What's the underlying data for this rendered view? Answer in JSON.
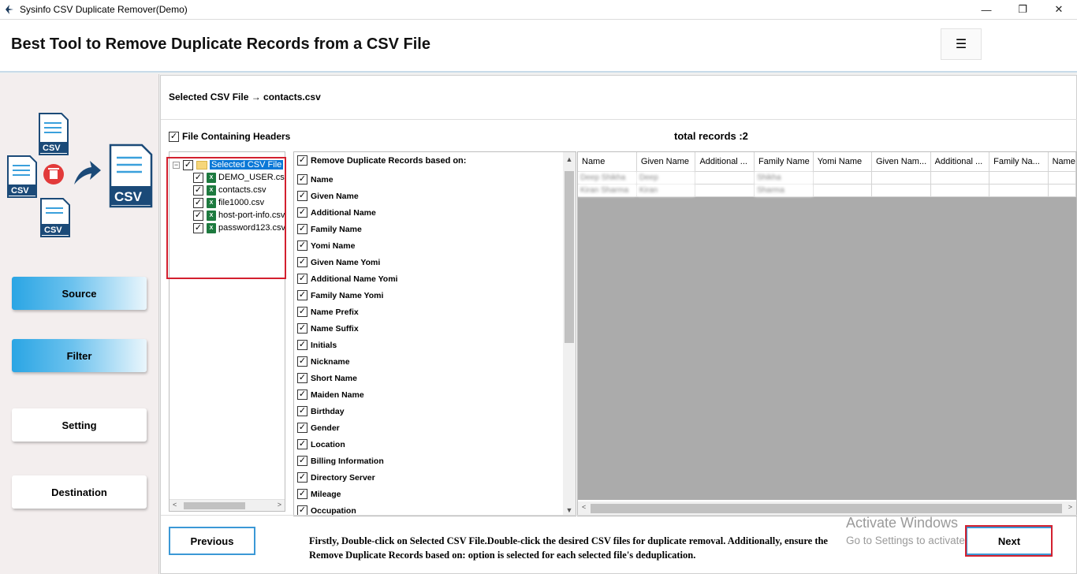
{
  "window": {
    "title": "Sysinfo CSV Duplicate Remover(Demo)",
    "minimize_glyph": "—",
    "restore_glyph": "❐",
    "close_glyph": "✕"
  },
  "header": {
    "heading": "Best Tool to Remove Duplicate Records from a CSV File",
    "menu_glyph": "☰"
  },
  "sidebar": {
    "logo_csv_label": "CSV",
    "nav": [
      {
        "label": "Source",
        "active": true
      },
      {
        "label": "Filter",
        "active": true
      },
      {
        "label": "Setting",
        "active": false
      },
      {
        "label": "Destination",
        "active": false
      }
    ]
  },
  "main": {
    "selected_file_text": "Selected CSV File → contacts.csv",
    "headers_checkbox_label": "File Containing Headers",
    "total_records": "total records :2",
    "tree": {
      "root_label": "Selected CSV File",
      "files": [
        "DEMO_USER.csv",
        "contacts.csv",
        "file1000.csv",
        "host-port-info.csv",
        "password123.csv"
      ]
    },
    "fields_title": "Remove Duplicate Records based on:",
    "fields": [
      "Name",
      "Given Name",
      "Additional Name",
      "Family Name",
      "Yomi Name",
      "Given Name Yomi",
      "Additional Name Yomi",
      "Family Name Yomi",
      "Name Prefix",
      "Name Suffix",
      "Initials",
      "Nickname",
      "Short Name",
      "Maiden Name",
      "Birthday",
      "Gender",
      "Location",
      "Billing Information",
      "Directory Server",
      "Mileage",
      "Occupation"
    ],
    "grid": {
      "columns": [
        "Name",
        "Given Name",
        "Additional ...",
        "Family Name",
        "Yomi Name",
        "Given Nam...",
        "Additional ...",
        "Family Na...",
        "Name"
      ],
      "rows": [
        [
          "Deep Shikha",
          "Deep",
          "",
          "Shikha",
          "",
          "",
          "",
          "",
          ""
        ],
        [
          "Kiran Sharma",
          "Kiran",
          "",
          "Sharma",
          "",
          "",
          "",
          "",
          ""
        ]
      ]
    },
    "previous_label": "Previous",
    "next_label": "Next",
    "instructions": "Firstly, Double-click on Selected CSV File.Double-click the desired CSV files for duplicate removal. Additionally, ensure the Remove Duplicate Records based on: option is selected for each selected file's deduplication.",
    "activate_title": "Activate Windows",
    "activate_sub": "Go to Settings to activate Windows."
  },
  "colors": {
    "accent": "#2aa5e4",
    "button_border": "#3b98d6",
    "highlight_box": "#d3202f",
    "selection": "#0a78d7"
  }
}
